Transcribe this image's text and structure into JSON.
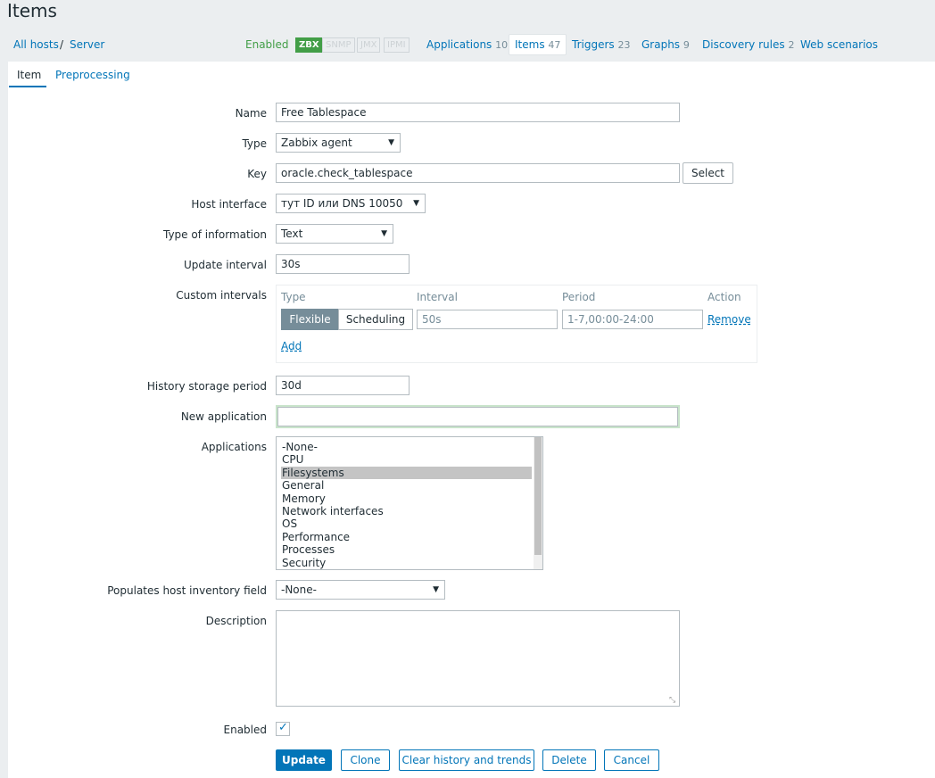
{
  "page": {
    "title": "Items"
  },
  "breadcrumb": {
    "all_hosts": "All hosts",
    "separator": "/",
    "host": "Server"
  },
  "host_status": {
    "enabled": "Enabled"
  },
  "availability": {
    "zbx": "ZBX",
    "snmp": "SNMP",
    "jmx": "JMX",
    "ipmi": "IPMI"
  },
  "host_tabs": [
    {
      "label": "Applications",
      "count": "10"
    },
    {
      "label": "Items",
      "count": "47"
    },
    {
      "label": "Triggers",
      "count": "23"
    },
    {
      "label": "Graphs",
      "count": "9"
    },
    {
      "label": "Discovery rules",
      "count": "2"
    },
    {
      "label": "Web scenarios",
      "count": ""
    }
  ],
  "form_tabs": {
    "item": "Item",
    "preprocessing": "Preprocessing"
  },
  "fields": {
    "name": {
      "label": "Name",
      "value": "Free Tablespace"
    },
    "type": {
      "label": "Type",
      "value": "Zabbix agent"
    },
    "key": {
      "label": "Key",
      "value": "oracle.check_tablespace",
      "button": "Select"
    },
    "host_interface": {
      "label": "Host interface",
      "value": "тут ID или DNS 10050"
    },
    "type_of_information": {
      "label": "Type of information",
      "value": "Text"
    },
    "update_interval": {
      "label": "Update interval",
      "value": "30s"
    },
    "custom_intervals": {
      "label": "Custom intervals",
      "headers": {
        "type": "Type",
        "interval": "Interval",
        "period": "Period",
        "action": "Action"
      },
      "row": {
        "flexible": "Flexible",
        "scheduling": "Scheduling",
        "interval_placeholder": "50s",
        "period_placeholder": "1-7,00:00-24:00",
        "remove": "Remove"
      },
      "add": "Add"
    },
    "history_storage_period": {
      "label": "History storage period",
      "value": "30d"
    },
    "new_application": {
      "label": "New application",
      "value": ""
    },
    "applications": {
      "label": "Applications",
      "options": [
        "-None-",
        "CPU",
        "Filesystems",
        "General",
        "Memory",
        "Network interfaces",
        "OS",
        "Performance",
        "Processes",
        "Security"
      ],
      "selected": "Filesystems"
    },
    "inventory_field": {
      "label": "Populates host inventory field",
      "value": "-None-"
    },
    "description": {
      "label": "Description",
      "value": ""
    },
    "enabled": {
      "label": "Enabled",
      "checked": true
    }
  },
  "buttons": {
    "update": "Update",
    "clone": "Clone",
    "clear_history": "Clear history and trends",
    "delete": "Delete",
    "cancel": "Cancel"
  }
}
